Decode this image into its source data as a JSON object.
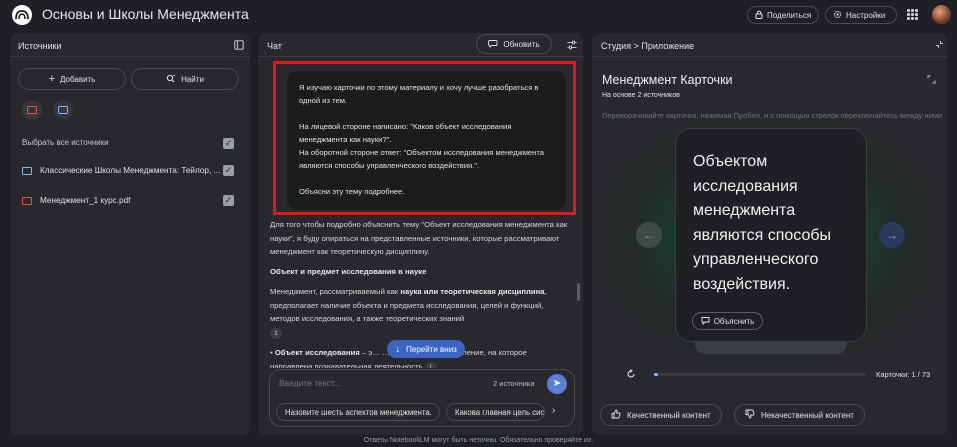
{
  "header": {
    "title": "Основы и Школы Менеджмента",
    "share_label": "Поделиться",
    "settings_label": "Настройки"
  },
  "sources": {
    "title": "Источники",
    "add_label": "Добавить",
    "find_label": "Найти",
    "select_all_label": "Выбрать все источники",
    "items": [
      {
        "label": "Классические Школы Менеджмента: Тейлор, ...",
        "icon": "doc-blue"
      },
      {
        "label": "Менеджмент_1 курс.pdf",
        "icon": "pdf-red"
      }
    ]
  },
  "chat": {
    "title": "Чат",
    "refresh_label": "Обновить",
    "user_message": [
      "Я изучаю карточки по этому материалу и хочу лучше разобраться в одной из тем.",
      "На лицевой стороне написано: \"Каков объект исследования менеджмента как науки?\".\nНа оборотной стороне ответ: \"Объектом исследования менеджмента являются способы управленческого воздействия.\".",
      "Объясни эту тему подробнее."
    ],
    "response": {
      "intro": "Для того чтобы подробно объяснить тему \"Объект исследования менеджмента как науки\", я буду опираться на представленные источники, которые рассматривают менеджмент как теоретическую дисциплину.",
      "heading": "Объект и предмет исследования в науке",
      "p2_a": "Менеджмент, рассматриваемый как ",
      "p2_bold": "наука или теоретическая дисциплина",
      "p2_b": ", предполагает наличие объекта и предмета исследования, целей и функций, методов исследования, а также теоретических знаний",
      "cite_1": "1",
      "bullet_bold": "Объект исследования",
      "bullet_rest": " – э… … менеджмент или явление, на которое направлена познавательная деятельность",
      "cite_2": "1"
    },
    "go_down_label": "Перейти вниз",
    "input_placeholder": "Введите текст...",
    "source_count": "2 источника",
    "suggestions": [
      "Назовите шесть аспектов менеджмента.",
      "Какова главная цель систе"
    ]
  },
  "studio": {
    "breadcrumb_root": "Студия",
    "breadcrumb_sep": ">",
    "breadcrumb_leaf": "Приложение",
    "title": "Менеджмент Карточки",
    "subtitle": "На основе 2 источников",
    "instructions": "Переворачивайте карточки, нажимая Пробел, и с помощью стрелок переключайтесь между ними.",
    "card_text": "Объектом исследования менеджмента являются способы управленческого воздействия.",
    "explain_label": "Объяснить",
    "counter": "Карточки: 1 / 73",
    "progress_fraction": 0.0137,
    "good_label": "Качественный контент",
    "bad_label": "Некачественный контент"
  },
  "footer": "Ответы NotebookLM могут быть неточны. Обязательно проверяйте их.",
  "colors": {
    "background": "#1f2023",
    "panel": "#28292c",
    "accent_blue": "#8ab4f8",
    "go_down": "#3b64c4",
    "highlight_red": "#e0191b",
    "card_glow": "#1e6e3f"
  }
}
